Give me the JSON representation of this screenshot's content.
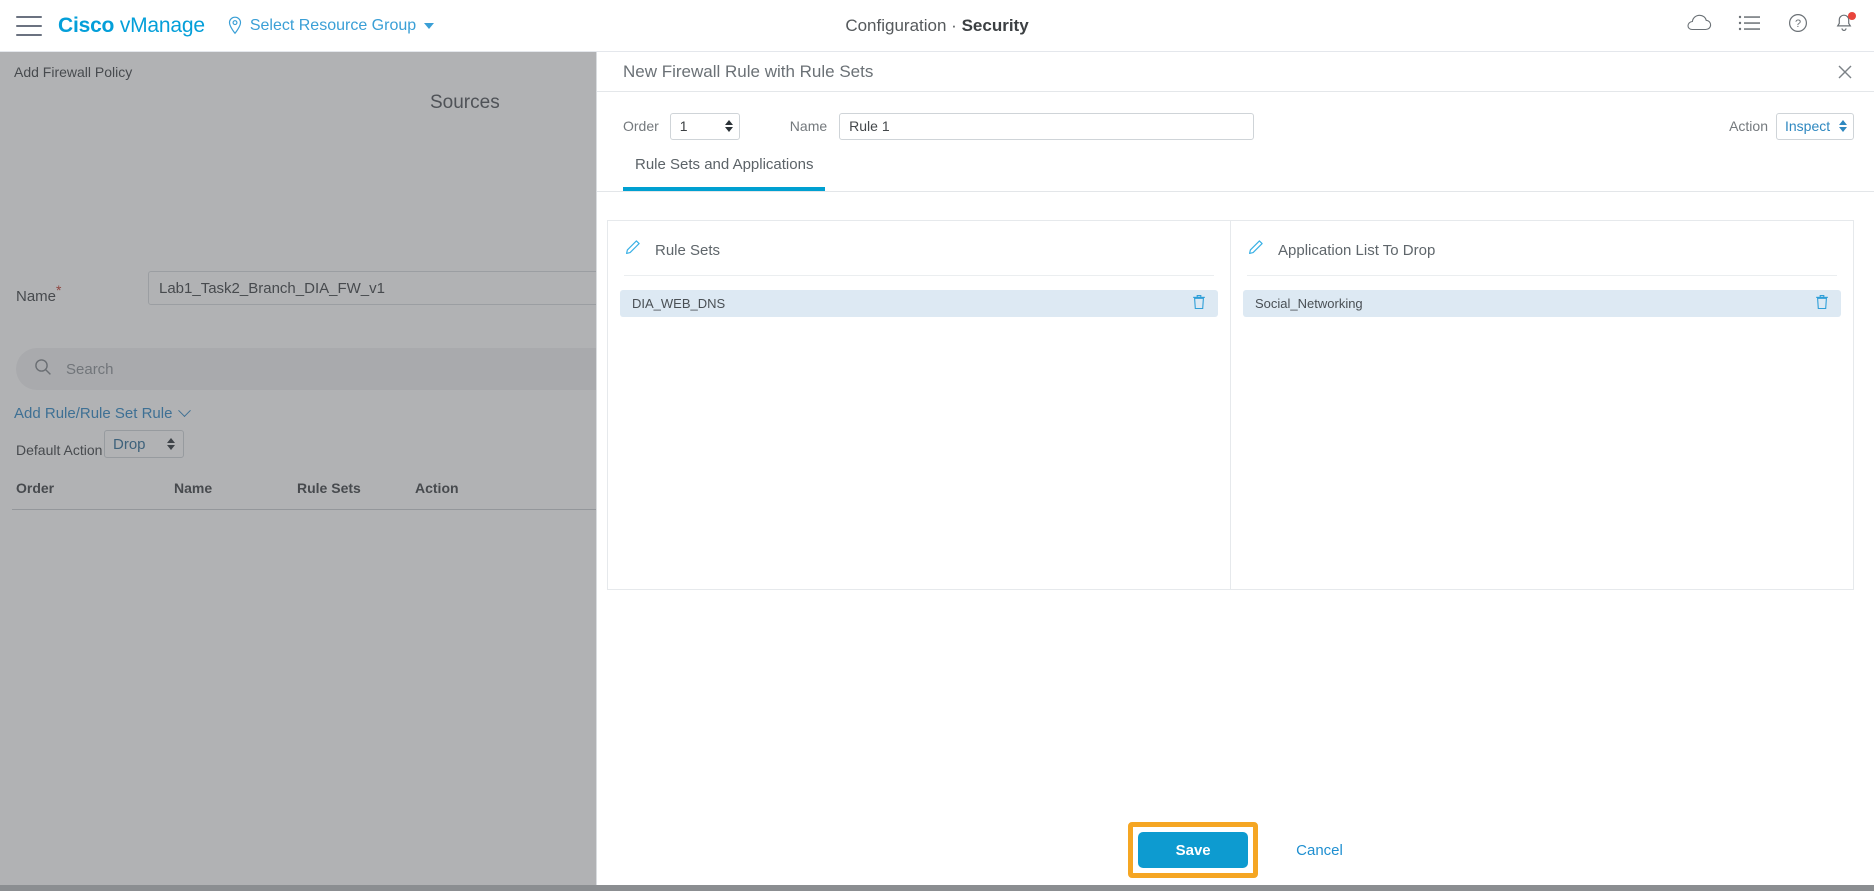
{
  "appbar": {
    "menu_icon": "hamburger-icon",
    "brand_bold": "Cisco",
    "brand_light": "vManage",
    "resource_group": "Select Resource Group",
    "title_primary": "Configuration",
    "title_separator": "·",
    "title_secondary": "Security",
    "icons": [
      "cloud-icon",
      "list-icon",
      "help-icon",
      "notifications-icon"
    ]
  },
  "background": {
    "breadcrumb": "Add Firewall Policy",
    "sources_heading": "Sources",
    "name_label": "Name",
    "name_required_marker": "*",
    "name_value": "Lab1_Task2_Branch_DIA_FW_v1",
    "search_placeholder": "Search",
    "add_rule_link": "Add Rule/Rule Set Rule",
    "default_action_label": "Default Action",
    "default_action_value": "Drop",
    "table_headers": [
      "Order",
      "Name",
      "Rule Sets",
      "Action"
    ]
  },
  "modal": {
    "title": "New Firewall Rule with Rule Sets",
    "close_icon": "close-icon",
    "order_label": "Order",
    "order_value": "1",
    "name_label": "Name",
    "name_value": "Rule 1",
    "name_placeholder": "",
    "action_label": "Action",
    "action_value": "Inspect",
    "tabs": [
      {
        "label": "Rule Sets and Applications",
        "active": true
      }
    ],
    "panels": [
      {
        "title": "Rule Sets",
        "edit_icon": "pencil-icon",
        "items": [
          {
            "label": "DIA_WEB_DNS",
            "delete_icon": "trash-icon"
          }
        ]
      },
      {
        "title": "Application List To Drop",
        "edit_icon": "pencil-icon",
        "items": [
          {
            "label": "Social_Networking",
            "delete_icon": "trash-icon"
          }
        ]
      }
    ],
    "save_label": "Save",
    "cancel_label": "Cancel"
  },
  "colors": {
    "brand_blue": "#049fd9",
    "accent_blue": "#00a0d1",
    "save_blue": "#0d9bd0",
    "highlight_orange": "#f5a623",
    "chip_blue": "#dde9f3",
    "notification_red": "#e8453c"
  }
}
